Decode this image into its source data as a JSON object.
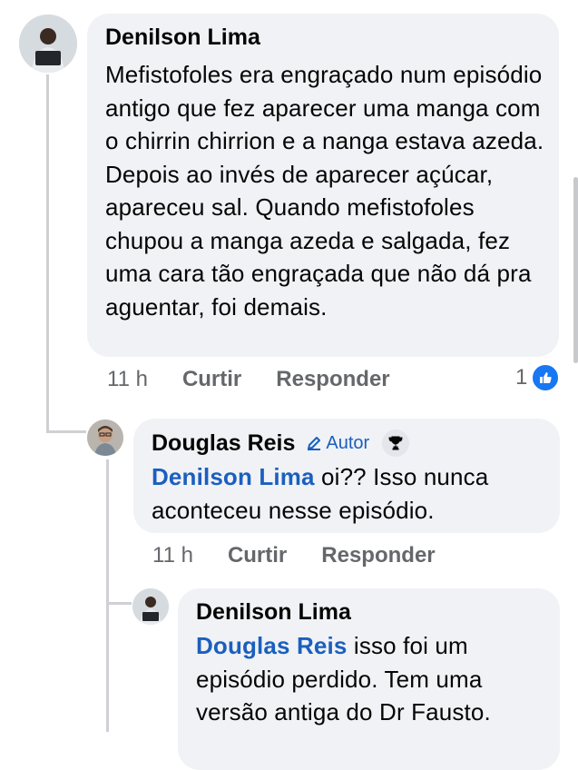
{
  "comments": [
    {
      "author": "Denilson Lima",
      "text": "Mefistofoles era engraçado num episódio antigo que fez aparecer uma manga com o chirrin chirrion e a nanga estava azeda. Depois ao invés de aparecer açúcar,  apareceu sal. Quando mefistofoles chupou a manga azeda e salgada, fez uma cara tão engraçada que não dá pra aguentar, foi demais.",
      "time": "11 h",
      "like_label": "Curtir",
      "reply_label": "Responder",
      "reaction_count": "1"
    },
    {
      "author": "Douglas Reis",
      "author_badge": "Autor",
      "mention": "Denilson Lima",
      "text": " oi?? Isso nunca aconteceu nesse episódio.",
      "time": "11 h",
      "like_label": "Curtir",
      "reply_label": "Responder"
    },
    {
      "author": "Denilson Lima",
      "mention": "Douglas Reis",
      "text": " isso foi um episódio perdido. Tem uma versão antiga do Dr Fausto."
    }
  ],
  "icons": {
    "author_badge": "pencil-icon",
    "trophy": "trophy-icon",
    "reaction": "thumbs-up-icon"
  },
  "colors": {
    "bubble": "#f0f2f5",
    "mention": "#1b5fbe",
    "meta": "#65676b",
    "like": "#1877f2"
  }
}
